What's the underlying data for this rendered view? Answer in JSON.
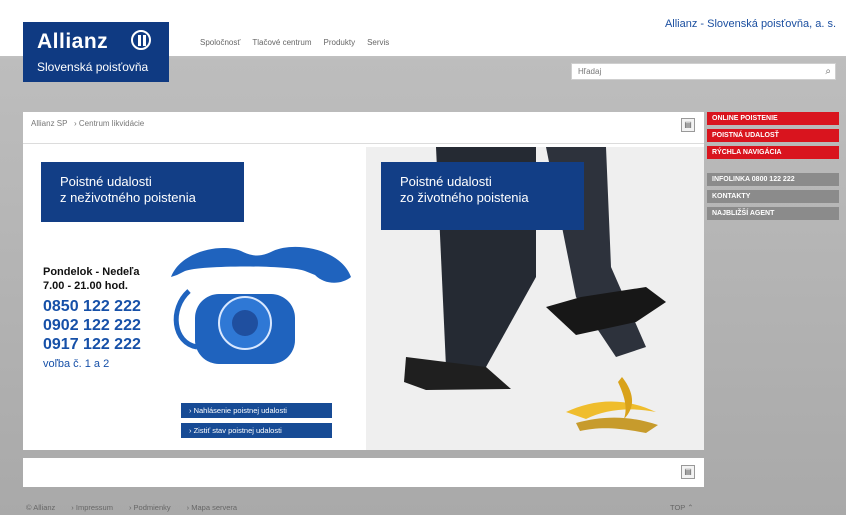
{
  "header": {
    "logo_brand": "Allianz",
    "logo_sub": "Slovenská poisťovňa",
    "company": "Allianz - Slovenská poisťovňa, a. s.",
    "nav": [
      "Spoločnosť",
      "Tlačové centrum",
      "Produkty",
      "Servis"
    ],
    "search_placeholder": "Hľadaj"
  },
  "breadcrumb": {
    "root": "Allianz SP",
    "current": "› Centrum likvidácie"
  },
  "left_panel": {
    "title_line1": "Poistné udalosti",
    "title_line2": "z neživotného poistenia",
    "hours_days": "Pondelok - Nedeľa",
    "hours_time": "7.00 - 21.00 hod.",
    "phones": [
      "0850 122 222",
      "0902 122 222",
      "0917 122 222"
    ],
    "choice": "voľba č. 1 a 2",
    "link1": "› Nahlásenie poistnej udalosti",
    "link2": "› Zistiť stav poistnej udalosti"
  },
  "right_panel": {
    "title_line1": "Poistné udalosti",
    "title_line2": "zo životného poistenia"
  },
  "sidebar": {
    "red_items": [
      "ONLINE POISTENIE",
      "POISTNÁ UDALOSŤ",
      "RÝCHLA NAVIGÁCIA"
    ],
    "gray_items": [
      "INFOLINKA 0800 122 222",
      "KONTAKTY",
      "NAJBLIŽŠÍ AGENT"
    ]
  },
  "footer": {
    "items": [
      "© Allianz",
      "› Impressum",
      "› Podmienky",
      "› Mapa servera"
    ],
    "right": "TOP ⌃"
  },
  "colors": {
    "brand_blue": "#123e86",
    "accent_red": "#d9141e"
  }
}
